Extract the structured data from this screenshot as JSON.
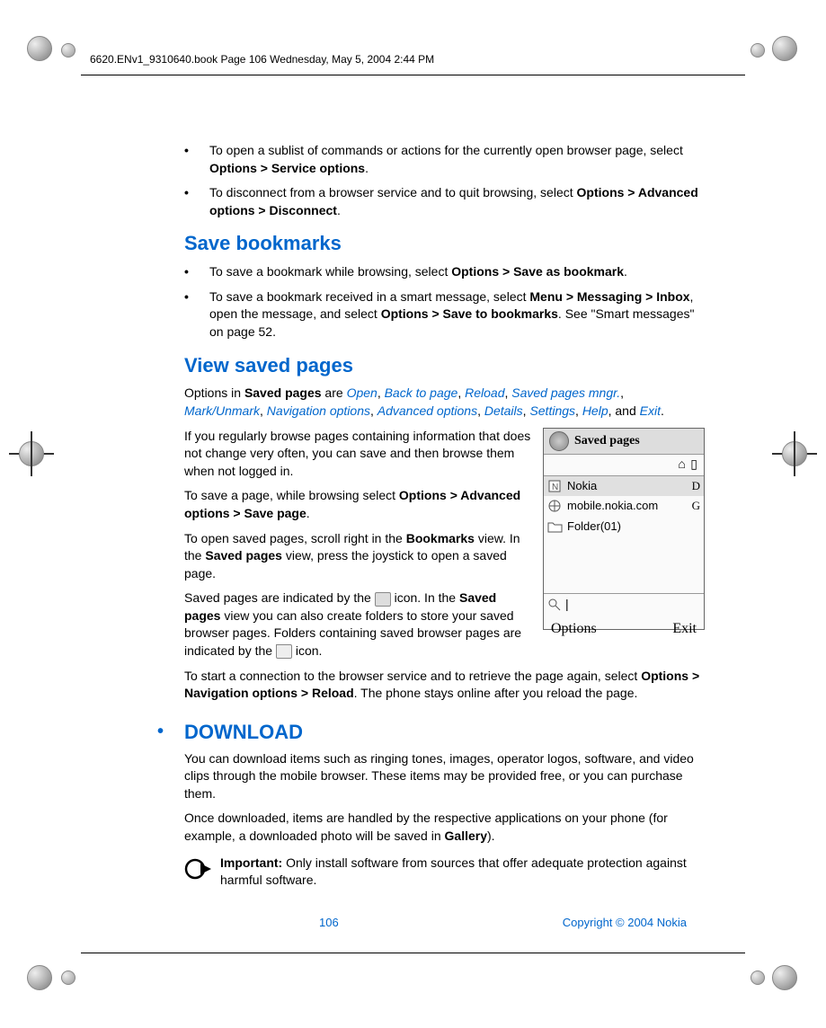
{
  "header": {
    "runningHead": "6620.ENv1_9310640.book  Page 106  Wednesday, May 5, 2004  2:44 PM"
  },
  "bullets_top": [
    {
      "pre": "To open a sublist of commands or actions for the currently open browser page, select ",
      "bold": "Options > Service options",
      "post": "."
    },
    {
      "pre": "To disconnect from a browser service and to quit browsing, select ",
      "bold": "Options > Advanced options > Disconnect",
      "post": "."
    }
  ],
  "saveBookmarks": {
    "title": "Save bookmarks",
    "items": [
      {
        "pre": "To save a bookmark while browsing, select ",
        "bold": "Options > Save as bookmark",
        "post": "."
      },
      {
        "pre": "To save a bookmark received in a smart message, select ",
        "bold": "Menu > Messaging > Inbox",
        "post": ", open the message, and select ",
        "bold2": "Options > Save to bookmarks",
        "post2": ". See \"Smart messages\" on page 52."
      }
    ]
  },
  "viewSaved": {
    "title": "View saved pages",
    "optionsIntro": {
      "pre": "Options in ",
      "bold": "Saved pages",
      "mid": " are "
    },
    "optionsList": [
      "Open",
      "Back to page",
      "Reload",
      "Saved pages mngr.",
      "Mark/Unmark",
      "Navigation options",
      "Advanced options",
      "Details",
      "Settings",
      "Help"
    ],
    "optionsAnd": ", and ",
    "optionsLast": "Exit",
    "p1": "If you regularly browse pages containing information that does not change very often, you can save and then browse them when not logged in.",
    "p2": {
      "pre": "To save a page, while browsing select ",
      "bold": "Options > Advanced options > Save page",
      "post": "."
    },
    "p3": {
      "pre": "To open saved pages, scroll right in the ",
      "bold": "Bookmarks",
      "mid": " view. In the ",
      "bold2": "Saved pages",
      "post": " view, press the joystick to open a saved page."
    },
    "p4a": "Saved pages are indicated by the ",
    "p4b": " icon. In the ",
    "p4c": "Saved pages",
    "p4d": " view you can also create folders to store your saved browser pages. Folders containing saved browser pages are indicated by the ",
    "p4e": " icon.",
    "p5": {
      "pre": "To start a connection to the browser service and to retrieve the page again, select ",
      "bold": "Options > Navigation options > Reload",
      "post": ". The phone stays online after you reload the page."
    }
  },
  "download": {
    "title": "DOWNLOAD",
    "p1": {
      "pre": "You can download items such as ringing tones, images, operator logos, software, and video clips through the mobile browser. These items may be provided free, or you can purchase them."
    },
    "p2": {
      "pre": "Once downloaded, items are handled by the respective applications on your phone (for example, a downloaded photo will be saved in ",
      "bold": "Gallery",
      "post": ")."
    },
    "important": {
      "label": "Important:",
      "text": " Only install software from sources that offer adequate protection against harmful software."
    }
  },
  "phone": {
    "title": "Saved pages",
    "status": "⌂  ▯",
    "rows": [
      {
        "icon": "nokia",
        "label": "Nokia",
        "end": "D"
      },
      {
        "icon": "globe",
        "label": "mobile.nokia.com",
        "end": "G"
      },
      {
        "icon": "folder",
        "label": "Folder(01)",
        "end": ""
      }
    ],
    "softLeft": "Options",
    "softRight": "Exit"
  },
  "footer": {
    "page": "106",
    "copyright": "Copyright © 2004 Nokia"
  }
}
